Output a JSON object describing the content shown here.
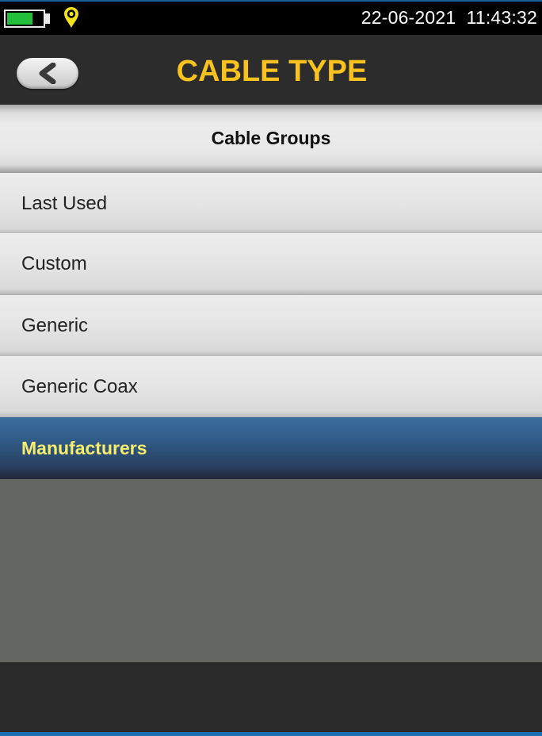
{
  "status_bar": {
    "datetime": "22-06-2021  11:43:32",
    "battery_level": 0.75,
    "battery_icon": "battery-icon",
    "location_icon": "location-pin-icon"
  },
  "header": {
    "title": "CABLE TYPE",
    "back_icon": "chevron-left-icon"
  },
  "section": {
    "title": "Cable Groups"
  },
  "list": {
    "items": [
      {
        "label": "Last Used",
        "selected": false
      },
      {
        "label": "Custom",
        "selected": false
      },
      {
        "label": "Generic",
        "selected": false
      },
      {
        "label": "Generic Coax",
        "selected": false
      },
      {
        "label": "Manufacturers",
        "selected": true
      }
    ]
  },
  "colors": {
    "title": "#f9c21e",
    "selected_text": "#f7ec6c",
    "selected_bg": "#2f5b86",
    "battery": "#22c03a"
  }
}
